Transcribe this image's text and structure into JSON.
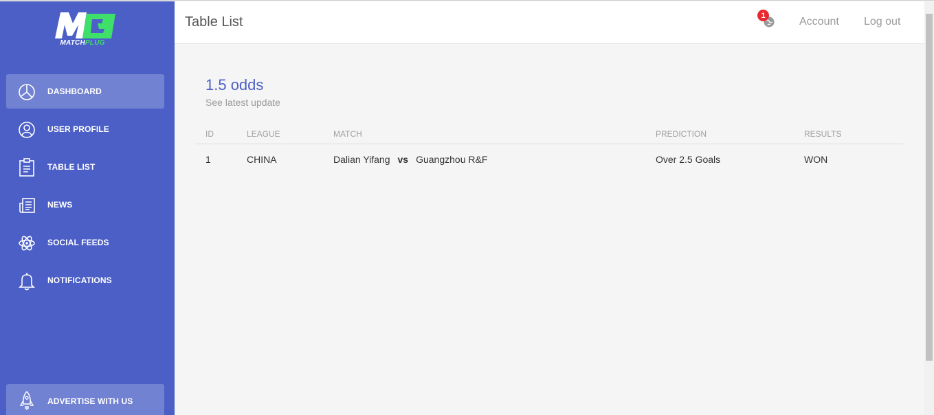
{
  "brand": {
    "logo_mark": "M",
    "logo_name_a": "MATCH",
    "logo_name_b": "PLUG"
  },
  "sidebar": {
    "items": [
      {
        "label": "DASHBOARD",
        "icon": "pie-chart-icon",
        "active": true
      },
      {
        "label": "USER PROFILE",
        "icon": "user-icon",
        "active": false
      },
      {
        "label": "TABLE LIST",
        "icon": "clipboard-icon",
        "active": false
      },
      {
        "label": "NEWS",
        "icon": "newspaper-icon",
        "active": false
      },
      {
        "label": "SOCIAL FEEDS",
        "icon": "atom-icon",
        "active": false
      },
      {
        "label": "NOTIFICATIONS",
        "icon": "bell-icon",
        "active": false
      }
    ],
    "advertise": {
      "label": "ADVERTISE WITH US",
      "icon": "rocket-icon"
    }
  },
  "header": {
    "title": "Table List",
    "notification_count": "1",
    "account_label": "Account",
    "logout_label": "Log out"
  },
  "card": {
    "title": "1.5 odds",
    "subtitle": "See latest update"
  },
  "table": {
    "columns": [
      "ID",
      "LEAGUE",
      "MATCH",
      "PREDICTION",
      "RESULTS"
    ],
    "rows": [
      {
        "id": "1",
        "league": "CHINA",
        "home": "Dalian Yifang",
        "vs": "vs",
        "away": "Guangzhou R&F",
        "prediction": "Over 2.5 Goals",
        "result": "WON"
      }
    ]
  },
  "colors": {
    "sidebar_bg": "#4b5fc6",
    "accent": "#4b5fc6",
    "logo_green": "#3fe06a",
    "badge_red": "#e8282f"
  }
}
